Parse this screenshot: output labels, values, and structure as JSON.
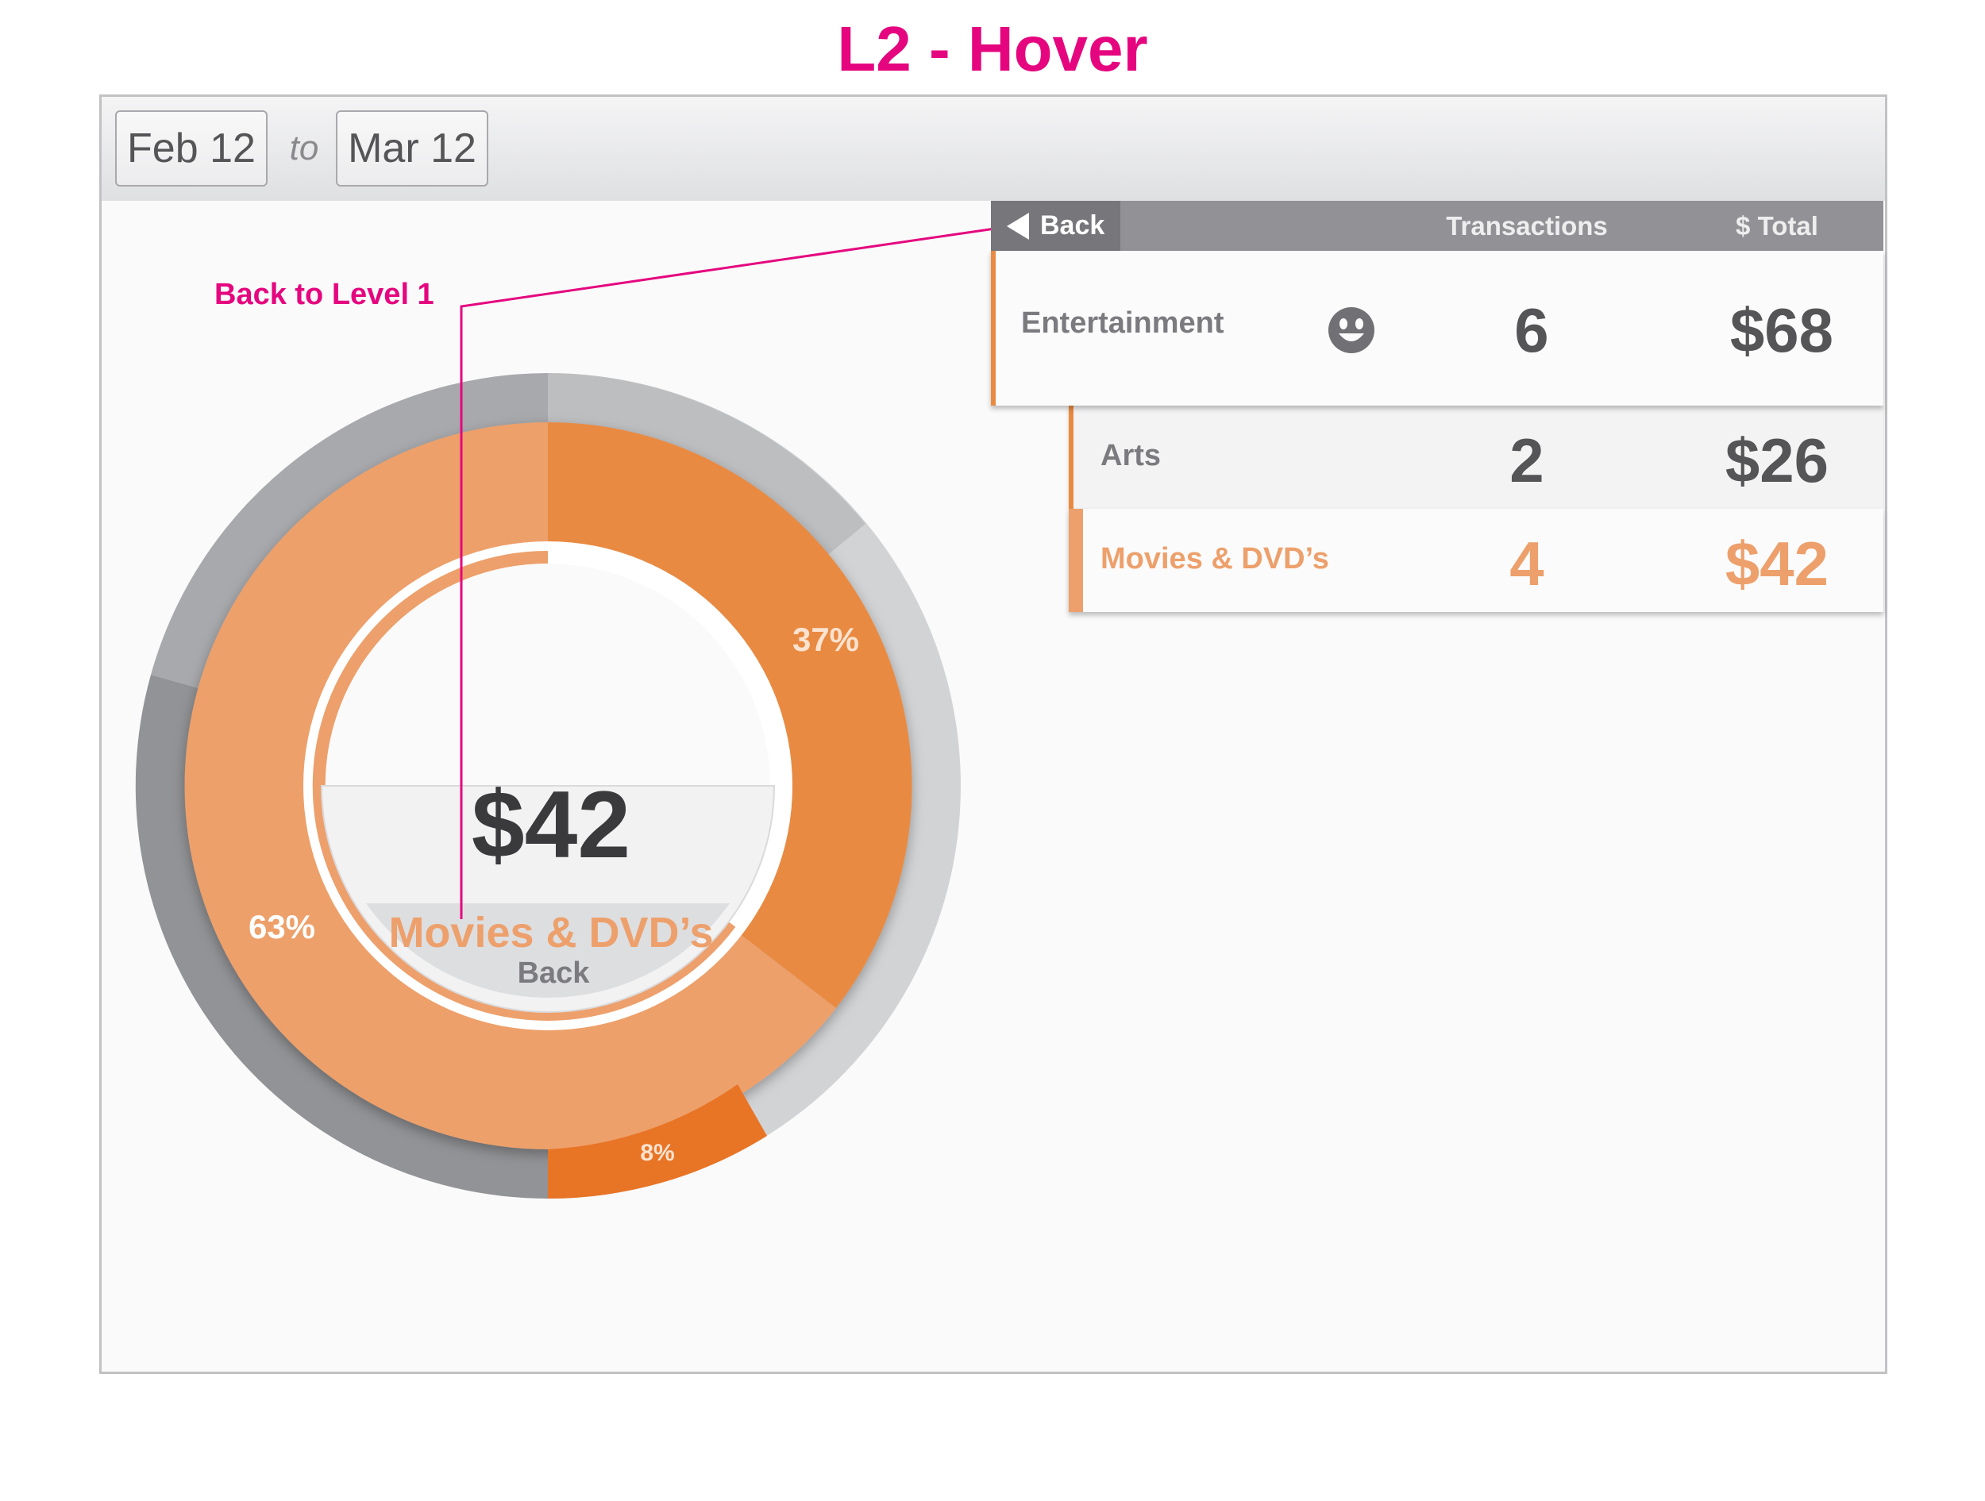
{
  "page_title": "L2 - Hover",
  "annotation": {
    "label": "Back to Level 1"
  },
  "date_range": {
    "from": "Feb 12",
    "separator": "to",
    "to": "Mar 12"
  },
  "donut": {
    "center_amount": "$42",
    "center_category": "Movies & DVD’s",
    "center_back": "Back",
    "segment_labels": {
      "arts": "37%",
      "movies": "63%",
      "small": "8%"
    }
  },
  "table": {
    "back_label": "Back",
    "columns": {
      "transactions": "Transactions",
      "total": "$ Total"
    },
    "parent": {
      "name": "Entertainment",
      "icon": "smiley-icon",
      "transactions": "6",
      "total": "$68"
    },
    "children": [
      {
        "name": "Arts",
        "transactions": "2",
        "total": "$26"
      },
      {
        "name": "Movies & DVD’s",
        "transactions": "4",
        "total": "$42"
      }
    ]
  },
  "colors": {
    "annotation": "#e5067f",
    "accent_dark": "#e98a42",
    "accent_light": "#eda06b",
    "accent_deep": "#e87426",
    "gray_text": "#555558"
  }
}
